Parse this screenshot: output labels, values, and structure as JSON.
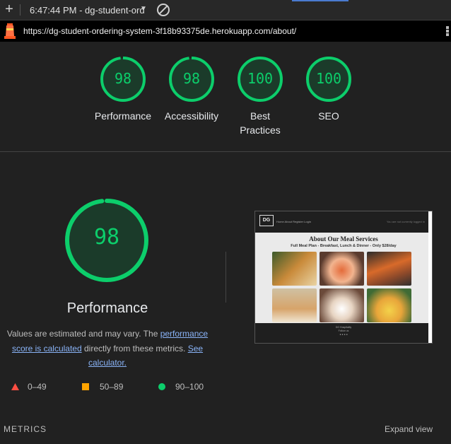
{
  "browser": {
    "time_title": "6:47:44 PM - dg-student-ord",
    "url": "https://dg-student-ordering-system-3f18b93375de.herokuapp.com/about/"
  },
  "summary": [
    {
      "score": "98",
      "label": "Performance"
    },
    {
      "score": "98",
      "label": "Accessibility"
    },
    {
      "score": "100",
      "label": "Best Practices"
    },
    {
      "score": "100",
      "label": "SEO"
    }
  ],
  "performance": {
    "score": "98",
    "title": "Performance",
    "desc_start": "Values are estimated and may vary. The ",
    "link1": "performance score is calculated",
    "desc_mid": " directly from these metrics. ",
    "link2": "See calculator."
  },
  "legend": [
    {
      "range": "0–49",
      "color": "#ff4e42",
      "shape": "triangle"
    },
    {
      "range": "50–89",
      "color": "#ffa400",
      "shape": "square"
    },
    {
      "range": "90–100",
      "color": "#0cce6b",
      "shape": "circle"
    }
  ],
  "metrics_label": "METRICS",
  "expand_label": "Expand view",
  "screenshot": {
    "logo": "DG",
    "nav": "Home  About  Register  Login",
    "nav_right": "You are not currently logged in",
    "heading": "About Our Meal Services",
    "subheading": "Full Meal Plan - Breakfast, Lunch & Dinner - Only $28/day",
    "footer_line1": "DG Hospitality",
    "footer_line2": "Follow us"
  },
  "colors": {
    "pass": "#0cce6b",
    "gauge_bg": "#1b3b2a"
  }
}
